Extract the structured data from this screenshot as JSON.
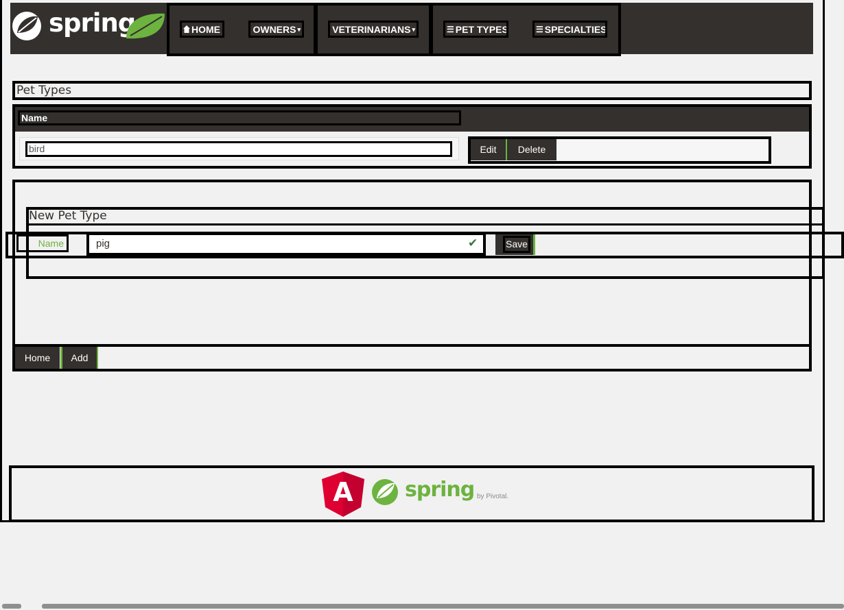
{
  "navbar": {
    "logo_text": "spring",
    "links": [
      {
        "label": "HOME",
        "icon": "home-icon"
      },
      {
        "label": "OWNERS",
        "icon": "caret-down-icon"
      },
      {
        "label": "VETERINARIANS",
        "icon": "caret-down-icon"
      },
      {
        "label": "PET TYPES",
        "icon": "list-icon"
      },
      {
        "label": "SPECIALTIES",
        "icon": "list-icon"
      }
    ]
  },
  "pet_types": {
    "heading": "Pet Types",
    "column_header": "Name",
    "rows": [
      {
        "name": "bird",
        "edit_label": "Edit",
        "delete_label": "Delete"
      }
    ]
  },
  "new_pet_type": {
    "heading": "New Pet Type",
    "name_label": "Name",
    "name_value": "pig",
    "save_label": "Save"
  },
  "bottom_buttons": {
    "home_label": "Home",
    "add_label": "Add"
  },
  "footer": {
    "angular_letter": "A",
    "spring_text": "spring",
    "pivotal_text": "by Pivotal."
  },
  "colors": {
    "brand_dark": "#34302d",
    "brand_green": "#6db33f",
    "angular_red": "#dd0031"
  }
}
